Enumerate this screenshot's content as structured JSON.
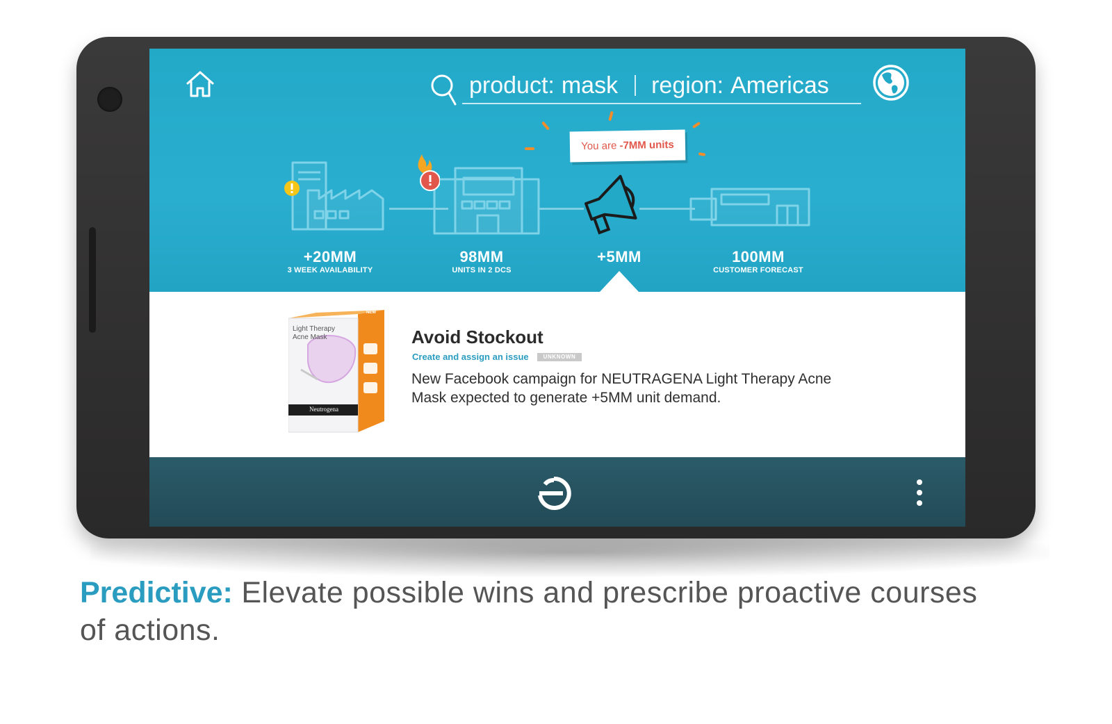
{
  "search": {
    "key1": "product:",
    "value1": "mask",
    "key2": "region:",
    "value2": "Americas"
  },
  "alert": {
    "prefix": "You are ",
    "amount": "-7MM units"
  },
  "pipeline": [
    {
      "value": "+20MM",
      "label": "3 WEEK AVAILABILITY",
      "icon": "factory-icon",
      "badge": "warning-yellow"
    },
    {
      "value": "98MM",
      "label": "UNITS IN 2 DCS",
      "icon": "warehouse-icon",
      "badge": "alert-red-fire"
    },
    {
      "value": "+5MM",
      "label": "",
      "icon": "megaphone-icon",
      "badge": "selected"
    },
    {
      "value": "100MM",
      "label": "CUSTOMER FORECAST",
      "icon": "store-icon",
      "badge": ""
    }
  ],
  "card": {
    "title": "Avoid Stockout",
    "link": "Create and assign an issue",
    "status": "UNKNOWN",
    "description": "New Facebook campaign for NEUTRAGENA Light Therapy Acne Mask expected to generate +5MM unit demand.",
    "product_box": {
      "corner": "NEW",
      "name_line1": "Light Therapy",
      "name_line2": "Acne Mask",
      "brand": "Neutrogena"
    }
  },
  "caption": {
    "highlight": "Predictive:",
    "text": " Elevate possible wins and prescribe proactive courses of actions."
  },
  "colors": {
    "hero": "#23a9c8",
    "accent": "#2a9cc0",
    "alert": "#e2574c",
    "bottom_bar": "#234a57",
    "spark": "#f28d2b"
  }
}
